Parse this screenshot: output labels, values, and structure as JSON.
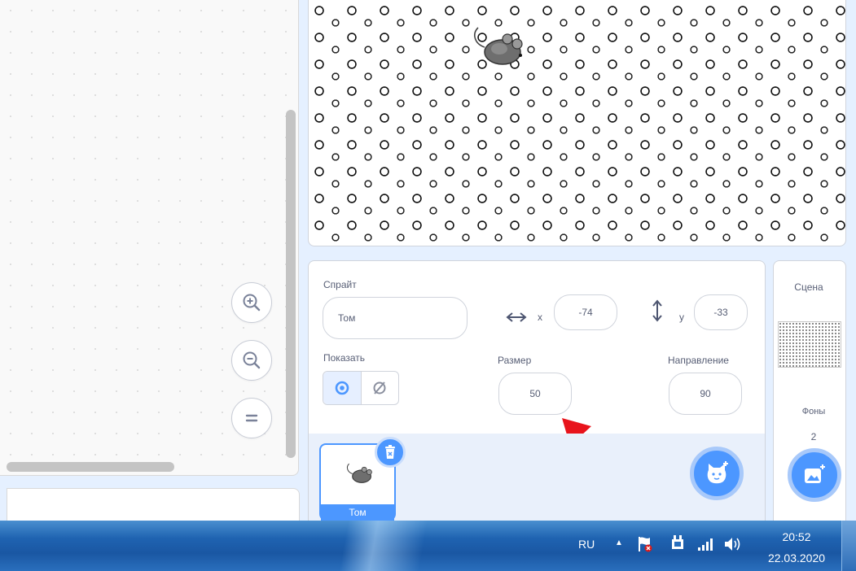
{
  "sprite_info": {
    "sprite_label": "Спрайт",
    "sprite_name": "Том",
    "x_label": "x",
    "x_value": "-74",
    "y_label": "y",
    "y_value": "-33",
    "show_label": "Показать",
    "size_label": "Размер",
    "size_value": "50",
    "direction_label": "Направление",
    "direction_value": "90"
  },
  "sprite_list": {
    "selected_sprite": "Том"
  },
  "stage_panel": {
    "title": "Сцена",
    "backdrops_label": "Фоны",
    "backdrops_count": "2"
  },
  "taskbar": {
    "language": "RU",
    "time": "20:52",
    "date": "22.03.2020"
  },
  "colors": {
    "accent": "#4c97ff",
    "arrow": "#e8141c"
  }
}
